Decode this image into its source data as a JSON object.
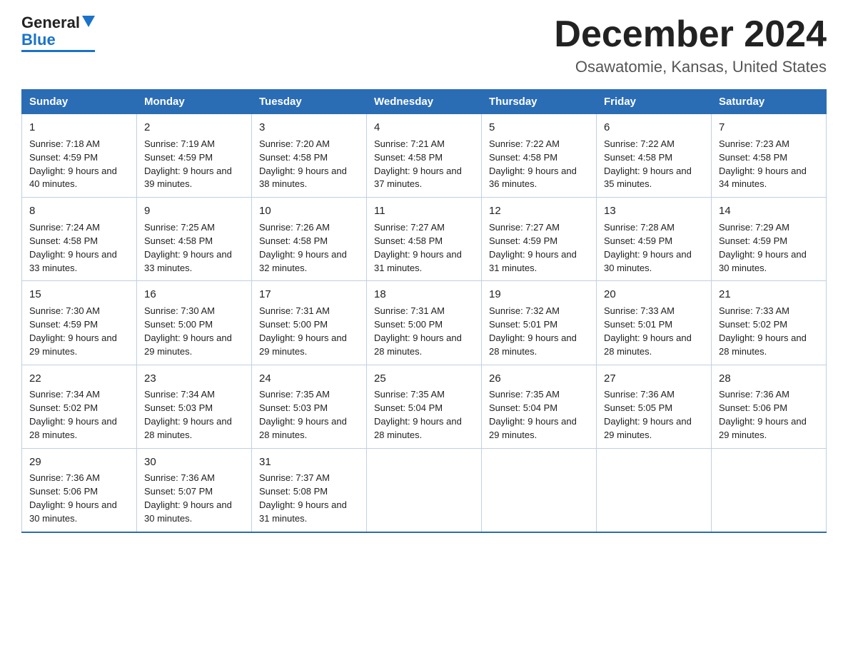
{
  "logo": {
    "general": "General",
    "blue": "Blue"
  },
  "header": {
    "title": "December 2024",
    "subtitle": "Osawatomie, Kansas, United States"
  },
  "days_of_week": [
    "Sunday",
    "Monday",
    "Tuesday",
    "Wednesday",
    "Thursday",
    "Friday",
    "Saturday"
  ],
  "weeks": [
    [
      {
        "num": "1",
        "sunrise": "7:18 AM",
        "sunset": "4:59 PM",
        "daylight": "9 hours and 40 minutes."
      },
      {
        "num": "2",
        "sunrise": "7:19 AM",
        "sunset": "4:59 PM",
        "daylight": "9 hours and 39 minutes."
      },
      {
        "num": "3",
        "sunrise": "7:20 AM",
        "sunset": "4:58 PM",
        "daylight": "9 hours and 38 minutes."
      },
      {
        "num": "4",
        "sunrise": "7:21 AM",
        "sunset": "4:58 PM",
        "daylight": "9 hours and 37 minutes."
      },
      {
        "num": "5",
        "sunrise": "7:22 AM",
        "sunset": "4:58 PM",
        "daylight": "9 hours and 36 minutes."
      },
      {
        "num": "6",
        "sunrise": "7:22 AM",
        "sunset": "4:58 PM",
        "daylight": "9 hours and 35 minutes."
      },
      {
        "num": "7",
        "sunrise": "7:23 AM",
        "sunset": "4:58 PM",
        "daylight": "9 hours and 34 minutes."
      }
    ],
    [
      {
        "num": "8",
        "sunrise": "7:24 AM",
        "sunset": "4:58 PM",
        "daylight": "9 hours and 33 minutes."
      },
      {
        "num": "9",
        "sunrise": "7:25 AM",
        "sunset": "4:58 PM",
        "daylight": "9 hours and 33 minutes."
      },
      {
        "num": "10",
        "sunrise": "7:26 AM",
        "sunset": "4:58 PM",
        "daylight": "9 hours and 32 minutes."
      },
      {
        "num": "11",
        "sunrise": "7:27 AM",
        "sunset": "4:58 PM",
        "daylight": "9 hours and 31 minutes."
      },
      {
        "num": "12",
        "sunrise": "7:27 AM",
        "sunset": "4:59 PM",
        "daylight": "9 hours and 31 minutes."
      },
      {
        "num": "13",
        "sunrise": "7:28 AM",
        "sunset": "4:59 PM",
        "daylight": "9 hours and 30 minutes."
      },
      {
        "num": "14",
        "sunrise": "7:29 AM",
        "sunset": "4:59 PM",
        "daylight": "9 hours and 30 minutes."
      }
    ],
    [
      {
        "num": "15",
        "sunrise": "7:30 AM",
        "sunset": "4:59 PM",
        "daylight": "9 hours and 29 minutes."
      },
      {
        "num": "16",
        "sunrise": "7:30 AM",
        "sunset": "5:00 PM",
        "daylight": "9 hours and 29 minutes."
      },
      {
        "num": "17",
        "sunrise": "7:31 AM",
        "sunset": "5:00 PM",
        "daylight": "9 hours and 29 minutes."
      },
      {
        "num": "18",
        "sunrise": "7:31 AM",
        "sunset": "5:00 PM",
        "daylight": "9 hours and 28 minutes."
      },
      {
        "num": "19",
        "sunrise": "7:32 AM",
        "sunset": "5:01 PM",
        "daylight": "9 hours and 28 minutes."
      },
      {
        "num": "20",
        "sunrise": "7:33 AM",
        "sunset": "5:01 PM",
        "daylight": "9 hours and 28 minutes."
      },
      {
        "num": "21",
        "sunrise": "7:33 AM",
        "sunset": "5:02 PM",
        "daylight": "9 hours and 28 minutes."
      }
    ],
    [
      {
        "num": "22",
        "sunrise": "7:34 AM",
        "sunset": "5:02 PM",
        "daylight": "9 hours and 28 minutes."
      },
      {
        "num": "23",
        "sunrise": "7:34 AM",
        "sunset": "5:03 PM",
        "daylight": "9 hours and 28 minutes."
      },
      {
        "num": "24",
        "sunrise": "7:35 AM",
        "sunset": "5:03 PM",
        "daylight": "9 hours and 28 minutes."
      },
      {
        "num": "25",
        "sunrise": "7:35 AM",
        "sunset": "5:04 PM",
        "daylight": "9 hours and 28 minutes."
      },
      {
        "num": "26",
        "sunrise": "7:35 AM",
        "sunset": "5:04 PM",
        "daylight": "9 hours and 29 minutes."
      },
      {
        "num": "27",
        "sunrise": "7:36 AM",
        "sunset": "5:05 PM",
        "daylight": "9 hours and 29 minutes."
      },
      {
        "num": "28",
        "sunrise": "7:36 AM",
        "sunset": "5:06 PM",
        "daylight": "9 hours and 29 minutes."
      }
    ],
    [
      {
        "num": "29",
        "sunrise": "7:36 AM",
        "sunset": "5:06 PM",
        "daylight": "9 hours and 30 minutes."
      },
      {
        "num": "30",
        "sunrise": "7:36 AM",
        "sunset": "5:07 PM",
        "daylight": "9 hours and 30 minutes."
      },
      {
        "num": "31",
        "sunrise": "7:37 AM",
        "sunset": "5:08 PM",
        "daylight": "9 hours and 31 minutes."
      },
      null,
      null,
      null,
      null
    ]
  ],
  "labels": {
    "sunrise": "Sunrise:",
    "sunset": "Sunset:",
    "daylight": "Daylight:"
  }
}
